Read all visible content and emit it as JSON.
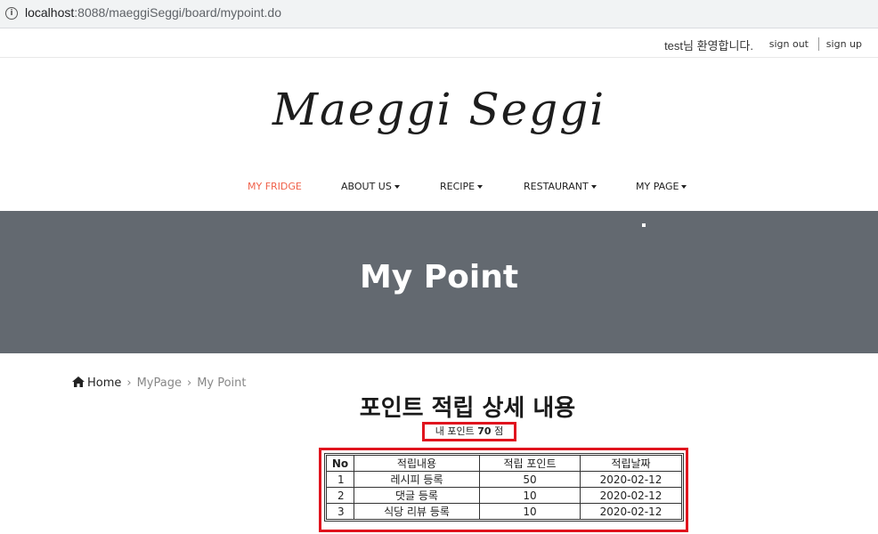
{
  "browser": {
    "url_host": "localhost",
    "url_rest": ":8088/maeggiSeggi/board/mypoint.do"
  },
  "userbar": {
    "welcome": "test님 환영합니다.",
    "signout": "sign out",
    "signup": "sign up"
  },
  "logo": "Maeggi Seggi",
  "nav": [
    {
      "label": "MY FRIDGE",
      "active": true
    },
    {
      "label": "ABOUT US",
      "dropdown": true
    },
    {
      "label": "RECIPE",
      "dropdown": true
    },
    {
      "label": "RESTAURANT",
      "dropdown": true
    },
    {
      "label": "MY PAGE",
      "dropdown": true
    }
  ],
  "banner": {
    "title": "My Point"
  },
  "breadcrumb": {
    "home": "Home",
    "items": [
      "MyPage",
      "My Point"
    ]
  },
  "heading": "포인트 적립 상세 내용",
  "mypoint": {
    "prefix": "내 포인트 ",
    "value": "70",
    "suffix": " 점"
  },
  "table": {
    "headers": [
      "No",
      "적립내용",
      "적립 포인트",
      "적립날짜"
    ],
    "rows": [
      [
        "1",
        "레시피 등록",
        "50",
        "2020-02-12"
      ],
      [
        "2",
        "댓글 등록",
        "10",
        "2020-02-12"
      ],
      [
        "3",
        "식당 리뷰 등록",
        "10",
        "2020-02-12"
      ]
    ]
  },
  "colors": {
    "accent": "#f0624b",
    "banner": "#636970",
    "highlight": "#e0141e"
  }
}
